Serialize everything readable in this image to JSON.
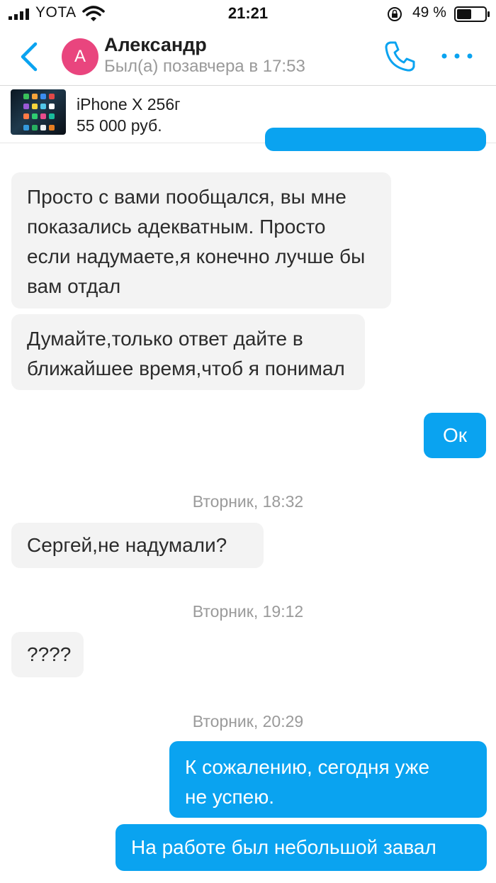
{
  "status_bar": {
    "carrier": "YOTA",
    "time": "21:21",
    "battery_percent": "49 %"
  },
  "header": {
    "avatar_letter": "А",
    "contact_name": "Александр",
    "contact_status": "Был(а) позавчера в 17:53"
  },
  "product": {
    "title": "iPhone X 256г",
    "price": "55 000 руб."
  },
  "messages": [
    {
      "side": "in",
      "lines": [
        "Просто с вами пообщался, вы мне",
        "показались адекватным. Просто",
        "если надумаете,я конечно лучше бы",
        "вам отдал"
      ]
    },
    {
      "side": "in",
      "lines": [
        "Думайте,только ответ дайте в",
        "ближайшее время,чтоб я понимал"
      ]
    },
    {
      "side": "out",
      "lines": [
        "Ок"
      ]
    },
    {
      "side": "in",
      "lines": [
        "Сергей,не надумали?"
      ]
    },
    {
      "side": "in",
      "lines": [
        "????"
      ]
    },
    {
      "side": "out",
      "lines": [
        "К сожалению, сегодня уже",
        "не успею."
      ]
    },
    {
      "side": "out",
      "lines": [
        "На работе был небольшой завал"
      ]
    }
  ],
  "date_separators": [
    "Вторник, 18:32",
    "Вторник, 19:12",
    "Вторник, 20:29"
  ],
  "colors": {
    "accent": "#0aa3f0",
    "avatar": "#e9457e",
    "incoming_bubble": "#f3f3f3"
  }
}
